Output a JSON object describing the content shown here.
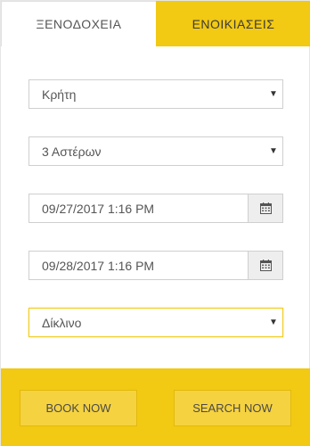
{
  "tabs": [
    {
      "label": "ΞΕΝΟΔΟΧΕΙΑ",
      "active": true
    },
    {
      "label": "ΕΝΟΙΚΙΑΣΕΙΣ",
      "active": false
    }
  ],
  "form": {
    "destination": {
      "value": "Κρήτη"
    },
    "stars": {
      "value": "3 Αστέρων"
    },
    "checkin": {
      "value": "09/27/2017 1:16 PM"
    },
    "checkout": {
      "value": "09/28/2017 1:16 PM"
    },
    "room_type": {
      "value": "Δίκλινο"
    }
  },
  "buttons": {
    "book": "BOOK NOW",
    "search": "SEARCH NOW"
  },
  "colors": {
    "accent": "#f2c913",
    "button": "#f5d23f"
  }
}
